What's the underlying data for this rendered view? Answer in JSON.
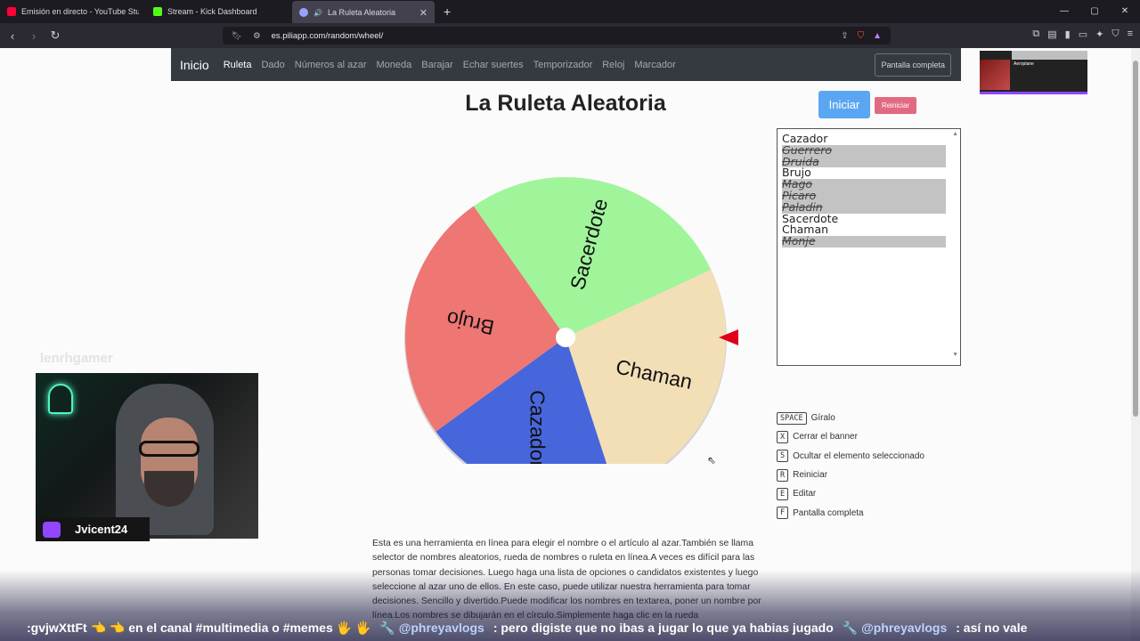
{
  "browser": {
    "tabs": [
      {
        "label": "Emisión en directo - YouTube Studio",
        "favicon_color": "#ff0033"
      },
      {
        "label": "Stream - Kick Dashboard",
        "favicon_color": "#53fc18"
      },
      {
        "label": "La Ruleta Aleatoria",
        "favicon_color": "#9aa0ff",
        "active": true
      }
    ],
    "new_tab": "+",
    "url": "es.piliapp.com/random/wheel/"
  },
  "site_nav": {
    "brand": "Inicio",
    "links": [
      "Ruleta",
      "Dado",
      "Números al azar",
      "Moneda",
      "Barajar",
      "Echar suertes",
      "Temporizador",
      "Reloj",
      "Marcador"
    ],
    "fullscreen": "Pantalla completa"
  },
  "main": {
    "title": "La Ruleta Aleatoria",
    "start_button": "Iniciar",
    "reset_button": "Reiniciar"
  },
  "wheel": {
    "slices": [
      {
        "label": "Sacerdote",
        "color": "#a0f59a"
      },
      {
        "label": "Chaman",
        "color": "#f3dfb6"
      },
      {
        "label": "Cazador",
        "color": "#4766db"
      },
      {
        "label": "Brujo",
        "color": "#ee7673"
      }
    ],
    "pointer_color": "#e0001a"
  },
  "names": [
    {
      "text": "Cazador",
      "selected": false
    },
    {
      "text": "Guerrero",
      "selected": true
    },
    {
      "text": "Druida",
      "selected": true
    },
    {
      "text": "Brujo",
      "selected": false
    },
    {
      "text": "Mago",
      "selected": true
    },
    {
      "text": "Picaro",
      "selected": true
    },
    {
      "text": "Paladin",
      "selected": true
    },
    {
      "text": "Sacerdote",
      "selected": false
    },
    {
      "text": "Chaman",
      "selected": false
    },
    {
      "text": "Monje",
      "selected": true
    }
  ],
  "shortcuts": [
    {
      "key": "SPACE",
      "label": "Gíralo"
    },
    {
      "key": "X",
      "label": "Cerrar el banner"
    },
    {
      "key": "S",
      "label": "Ocultar el elemento seleccionado"
    },
    {
      "key": "R",
      "label": "Reiniciar"
    },
    {
      "key": "E",
      "label": "Editar"
    },
    {
      "key": "F",
      "label": "Pantalla completa"
    }
  ],
  "description": "Esta es una herramienta en línea para elegir el nombre o el artículo al azar.También se llama selector de nombres aleatorios, rueda de nombres o ruleta en línea.A veces es difícil para las personas tomar decisiones. Luego haga una lista de opciones o candidatos existentes y luego seleccione al azar uno de ellos. En este caso, puede utilizar nuestra herramienta para tomar decisiones. Sencillo y divertido.Puede modificar los nombres en textarea, poner un nombre por línea.Los nombres se dibujarán en el círculo.Simplemente haga clic en la rueda",
  "overlay": {
    "webcam_name": "Jvicent24",
    "ghost_handle": "lenrhgamer",
    "preview_title": "Aeroplane",
    "ticker": [
      {
        "text": ":gvjwXttFt 👈 👈 en el canal #multimedia o #memes 🖐 🖐",
        "mention": false
      },
      {
        "text": "🔧 @phreyavlogs",
        "mention": true
      },
      {
        "text": ": pero digiste que no ibas a jugar lo que ya habias jugado",
        "mention": false
      },
      {
        "text": "🔧 @phreyavlogs",
        "mention": true
      },
      {
        "text": ": así no vale",
        "mention": false
      }
    ]
  }
}
